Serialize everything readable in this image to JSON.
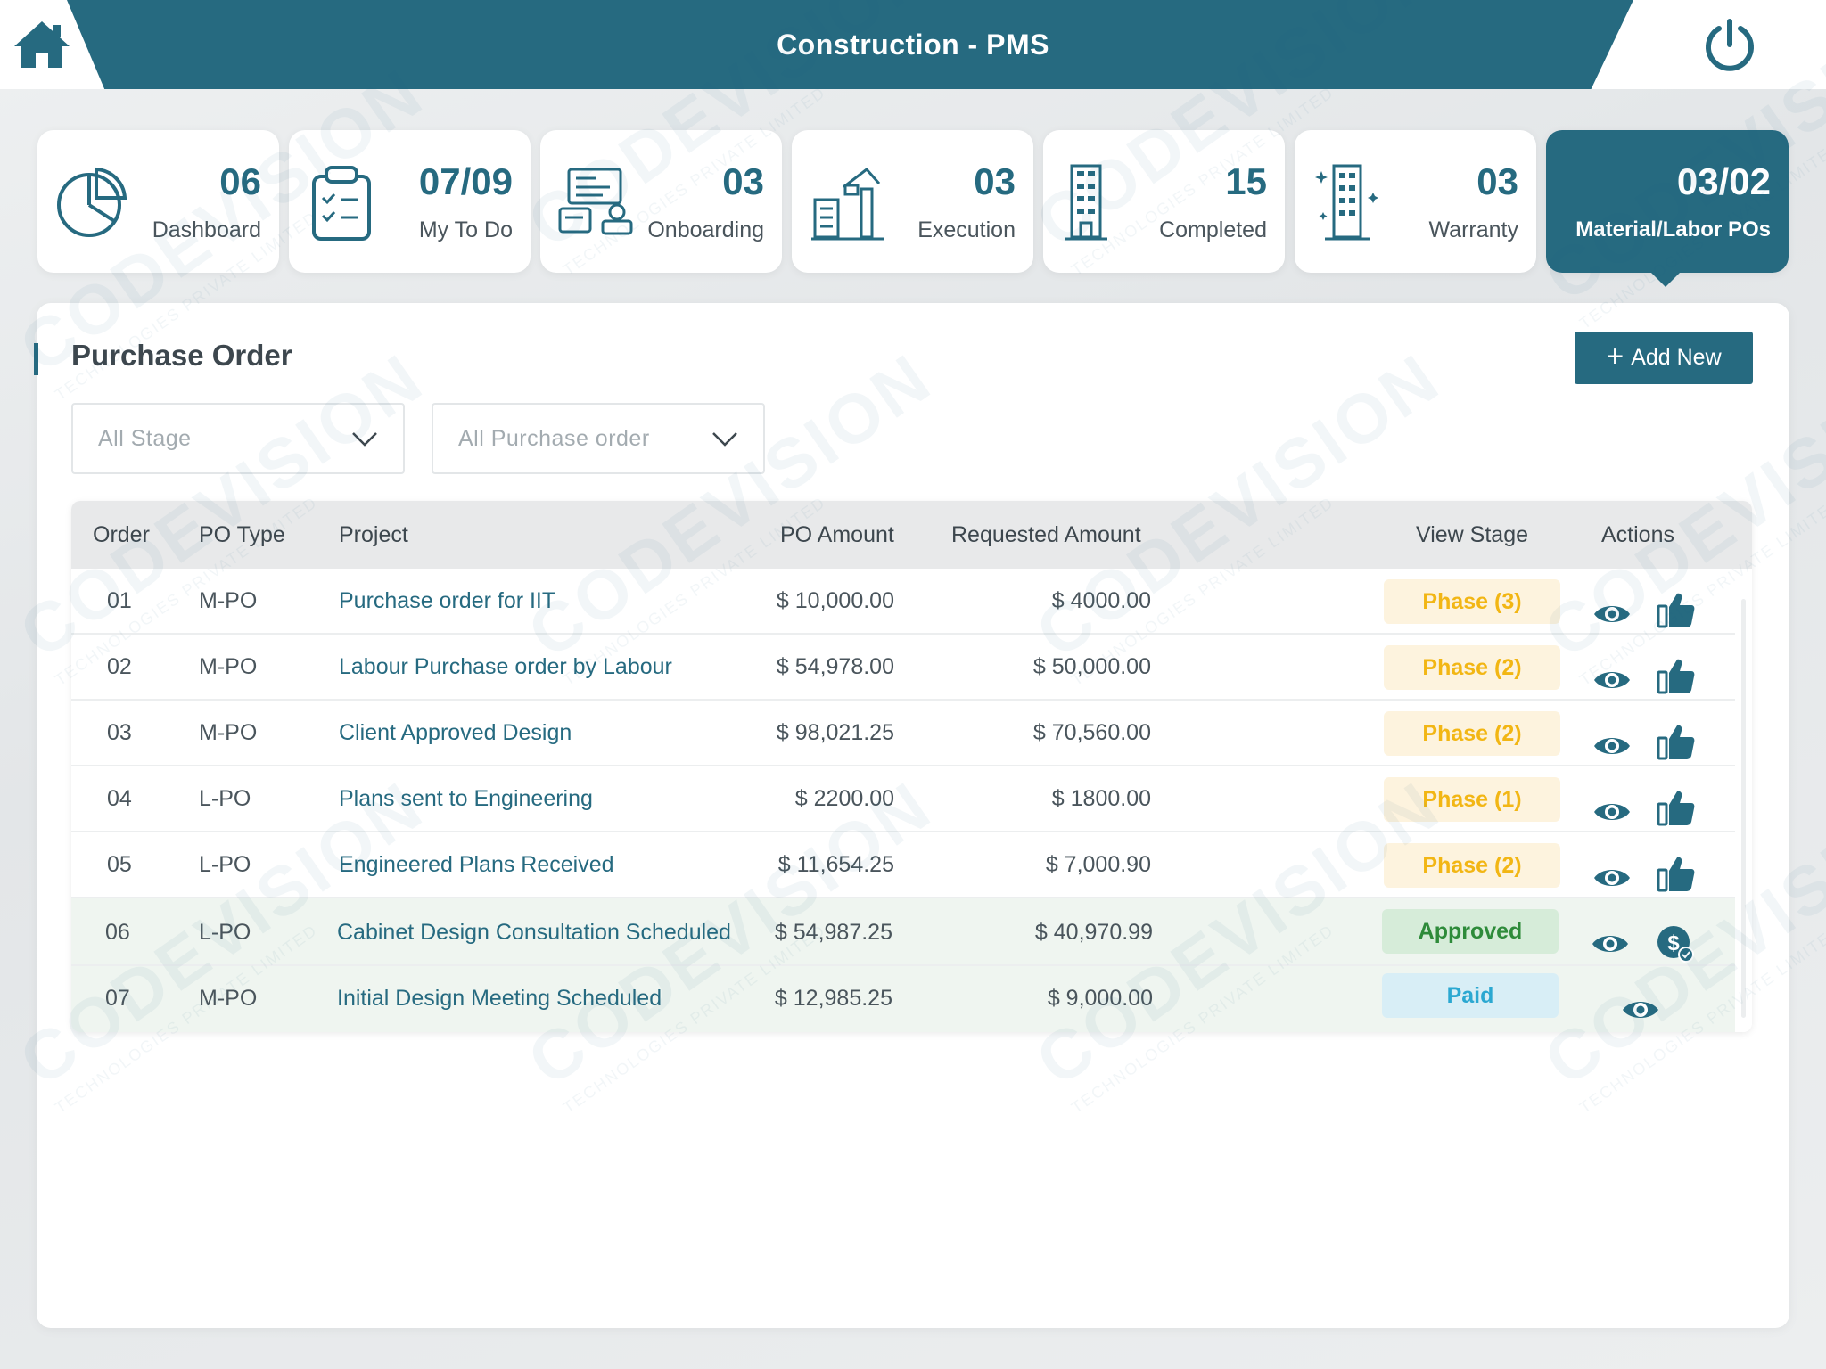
{
  "header": {
    "title": "Construction - PMS",
    "home_icon": "home-icon",
    "power_icon": "power-icon"
  },
  "cards": [
    {
      "count": "06",
      "label": "Dashboard",
      "icon": "pie-chart-icon"
    },
    {
      "count": "07/09",
      "label": "My To Do",
      "icon": "checklist-icon"
    },
    {
      "count": "03",
      "label": "Onboarding",
      "icon": "onboarding-icon"
    },
    {
      "count": "03",
      "label": "Execution",
      "icon": "crane-building-icon"
    },
    {
      "count": "15",
      "label": "Completed",
      "icon": "building-icon"
    },
    {
      "count": "03",
      "label": "Warranty",
      "icon": "sparkle-building-icon"
    },
    {
      "count": "03/02",
      "label": "Material/Labor POs",
      "icon": "",
      "active": true
    }
  ],
  "panel": {
    "title": "Purchase Order",
    "add_button": "Add New",
    "filters": {
      "stage_placeholder": "All Stage",
      "po_placeholder": "All Purchase order"
    }
  },
  "table": {
    "columns": [
      "Order",
      "PO Type",
      "Project",
      "PO Amount",
      "Requested Amount",
      "View Stage",
      "Actions"
    ],
    "rows": [
      {
        "order": "01",
        "type": "M-PO",
        "project": "Purchase order for IIT",
        "po_amount": "$ 10,000.00",
        "requested": "$ 4000.00",
        "stage": "Phase (3)",
        "stage_kind": "phase",
        "actions": [
          "view",
          "approve"
        ]
      },
      {
        "order": "02",
        "type": "M-PO",
        "project": "Labour Purchase order by Labour",
        "po_amount": "$ 54,978.00",
        "requested": "$ 50,000.00",
        "stage": "Phase (2)",
        "stage_kind": "phase",
        "actions": [
          "view",
          "approve"
        ]
      },
      {
        "order": "03",
        "type": "M-PO",
        "project": "Client Approved Design",
        "po_amount": "$ 98,021.25",
        "requested": "$ 70,560.00",
        "stage": "Phase (2)",
        "stage_kind": "phase",
        "actions": [
          "view",
          "approve"
        ]
      },
      {
        "order": "04",
        "type": "L-PO",
        "project": "Plans sent to Engineering",
        "po_amount": "$ 2200.00",
        "requested": "$ 1800.00",
        "stage": "Phase (1)",
        "stage_kind": "phase",
        "actions": [
          "view",
          "approve"
        ]
      },
      {
        "order": "05",
        "type": "L-PO",
        "project": "Engineered Plans Received",
        "po_amount": "$ 11,654.25",
        "requested": "$ 7,000.90",
        "stage": "Phase (2)",
        "stage_kind": "phase",
        "actions": [
          "view",
          "approve"
        ]
      },
      {
        "order": "06",
        "type": "L-PO",
        "project": "Cabinet Design Consultation Scheduled",
        "po_amount": "$ 54,987.25",
        "requested": "$ 40,970.99",
        "stage": "Approved",
        "stage_kind": "approved",
        "actions": [
          "view",
          "pay"
        ]
      },
      {
        "order": "07",
        "type": "M-PO",
        "project": "Initial Design Meeting Scheduled",
        "po_amount": "$ 12,985.25",
        "requested": "$ 9,000.00",
        "stage": "Paid",
        "stage_kind": "paid",
        "actions": [
          "view"
        ]
      }
    ]
  },
  "watermark": {
    "brand": "CODEVISION",
    "sub": "TECHNOLOGIES PRIVATE LIMITED"
  },
  "colors": {
    "brand": "#266a80",
    "phase_text": "#f2b614",
    "approved_text": "#2e8b3a",
    "paid_text": "#2ba8d1"
  }
}
